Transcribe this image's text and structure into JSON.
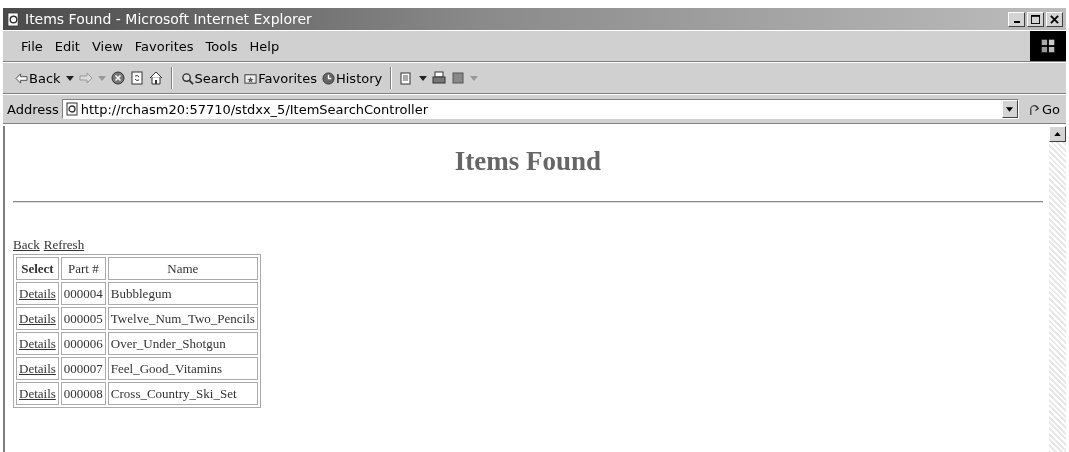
{
  "window": {
    "title": "Items Found - Microsoft Internet Explorer"
  },
  "menu": [
    "File",
    "Edit",
    "View",
    "Favorites",
    "Tools",
    "Help"
  ],
  "toolbar": {
    "back": "Back",
    "search": "Search",
    "favorites": "Favorites",
    "history": "History",
    "forward_disabled": true
  },
  "address": {
    "label": "Address",
    "value": "http://rchasm20:57710/stdxx_5/ItemSearchController",
    "go": "Go"
  },
  "page": {
    "heading": "Items Found",
    "links": [
      "Back",
      "Refresh"
    ],
    "table": {
      "columns": [
        "Select",
        "Part #",
        "Name"
      ],
      "rows": [
        {
          "select": "Details",
          "part": "000004",
          "name": "Bubblegum"
        },
        {
          "select": "Details",
          "part": "000005",
          "name": "Twelve_Num_Two_Pencils"
        },
        {
          "select": "Details",
          "part": "000006",
          "name": "Over_Under_Shotgun"
        },
        {
          "select": "Details",
          "part": "000007",
          "name": "Feel_Good_Vitamins"
        },
        {
          "select": "Details",
          "part": "000008",
          "name": "Cross_Country_Ski_Set"
        }
      ]
    }
  }
}
